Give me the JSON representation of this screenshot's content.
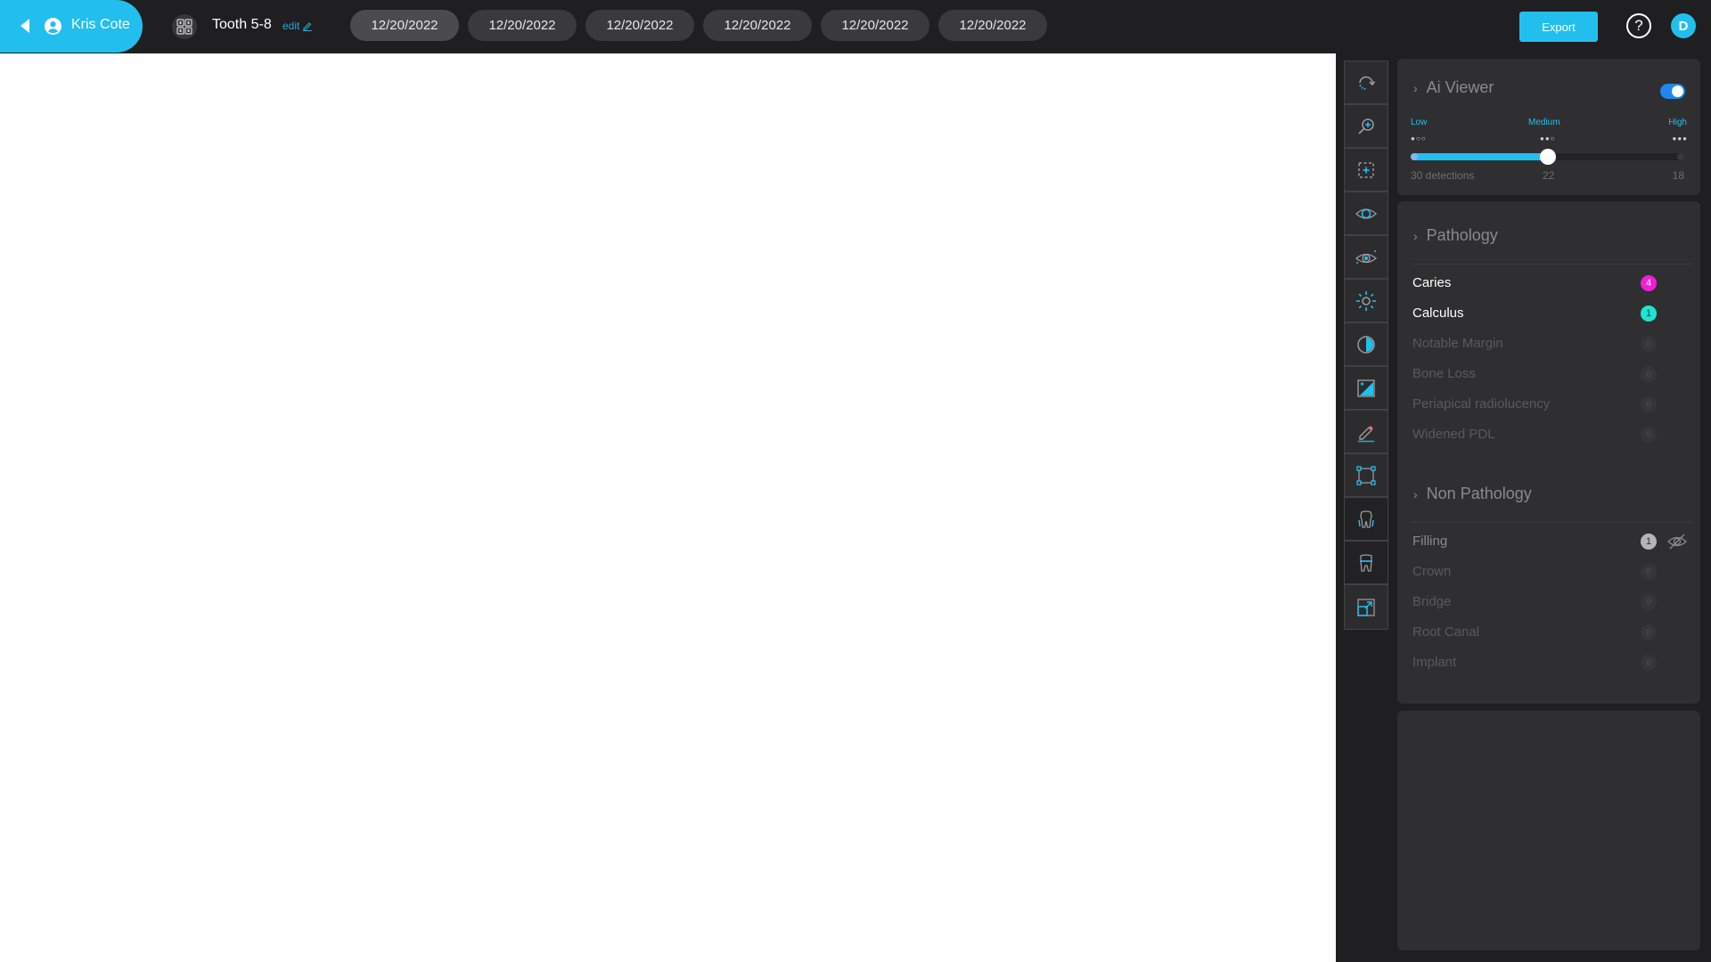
{
  "header": {
    "patient_name": "Kris Cote",
    "tooth_title": "Tooth 5-8",
    "edit_label": "edit",
    "date_tabs": [
      {
        "label": "12/20/2022",
        "active": true
      },
      {
        "label": "12/20/2022",
        "active": false
      },
      {
        "label": "12/20/2022",
        "active": false
      },
      {
        "label": "12/20/2022",
        "active": false
      },
      {
        "label": "12/20/2022",
        "active": false
      },
      {
        "label": "12/20/2022",
        "active": false
      }
    ],
    "export_label": "Export",
    "help_label": "?",
    "avatar_initial": "D"
  },
  "toolbar": {
    "tools": [
      {
        "name": "rotate-icon",
        "label": "Rotate"
      },
      {
        "name": "zoom-in-icon",
        "label": "Zoom"
      },
      {
        "name": "select-region-icon",
        "label": "Select region"
      },
      {
        "name": "eye-icon",
        "label": "View"
      },
      {
        "name": "eye-focus-icon",
        "label": "Focus view"
      },
      {
        "name": "brightness-icon",
        "label": "Brightness"
      },
      {
        "name": "contrast-icon",
        "label": "Contrast"
      },
      {
        "name": "image-adjust-icon",
        "label": "Image adjust"
      },
      {
        "name": "pencil-icon",
        "label": "Draw"
      },
      {
        "name": "bounding-box-icon",
        "label": "Bounding box"
      },
      {
        "name": "tooth-roots-icon",
        "label": "Tooth roots"
      },
      {
        "name": "tooth-crown-icon",
        "label": "Tooth crown"
      },
      {
        "name": "expand-icon",
        "label": "Expand"
      }
    ]
  },
  "ai_viewer": {
    "title": "Ai Viewer",
    "enabled": true,
    "levels": [
      {
        "label": "Low",
        "dots": "●○○",
        "count": "30 detections"
      },
      {
        "label": "Medium",
        "dots": "●●○",
        "count": "22"
      },
      {
        "label": "High",
        "dots": "●●●",
        "count": "18"
      }
    ],
    "sensitivity_fraction": 0.5
  },
  "pathology": {
    "title": "Pathology",
    "items": [
      {
        "label": "Caries",
        "count": "4",
        "active": true,
        "color": "#ee1fd6"
      },
      {
        "label": "Calculus",
        "count": "1",
        "active": true,
        "color": "#1de5d1"
      },
      {
        "label": "Notable Margin",
        "count": "0",
        "active": false
      },
      {
        "label": "Bone Loss",
        "count": "0",
        "active": false
      },
      {
        "label": "Periapical radiolucency",
        "count": "0",
        "active": false
      },
      {
        "label": "Widened PDL",
        "count": "0",
        "active": false
      }
    ]
  },
  "non_pathology": {
    "title": "Non Pathology",
    "items": [
      {
        "label": "Filling",
        "count": "1",
        "active": true,
        "hidden": true,
        "color": "#b5b5b8"
      },
      {
        "label": "Crown",
        "count": "0",
        "active": false
      },
      {
        "label": "Bridge",
        "count": "0",
        "active": false
      },
      {
        "label": "Root Canal",
        "count": "0",
        "active": false
      },
      {
        "label": "Implant",
        "count": "0",
        "active": false
      }
    ]
  }
}
